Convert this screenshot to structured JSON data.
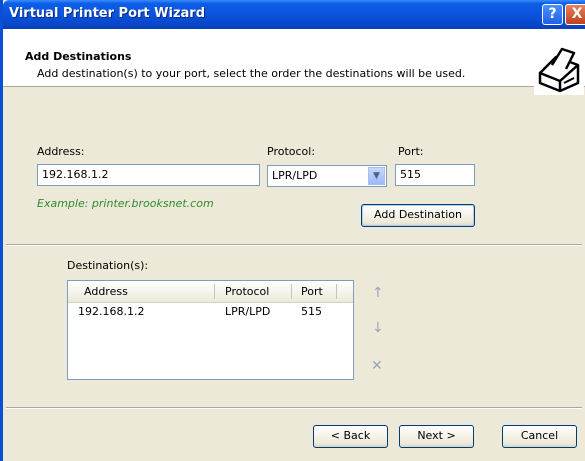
{
  "window": {
    "title": "Virtual Printer Port Wizard",
    "help_label": "?",
    "close_label": "X"
  },
  "header": {
    "title": "Add Destinations",
    "subtitle": "Add destination(s) to your port, select the order the destinations will be used."
  },
  "form": {
    "address_label": "Address:",
    "address_value": "192.168.1.2",
    "protocol_label": "Protocol:",
    "protocol_value": "LPR/LPD",
    "port_label": "Port:",
    "port_value": "515",
    "example_text": "Example: printer.brooksnet.com",
    "add_destination_label": "Add Destination"
  },
  "destinations": {
    "label": "Destination(s):",
    "columns": [
      "Address",
      "Protocol",
      "Port"
    ],
    "rows": [
      {
        "address": "192.168.1.2",
        "protocol": "LPR/LPD",
        "port": "515"
      }
    ]
  },
  "side_buttons": {
    "up": "↑",
    "down": "↓",
    "remove": "✕"
  },
  "footer": {
    "back_label": "< Back",
    "next_label": "Next >",
    "cancel_label": "Cancel"
  },
  "colors": {
    "title_bar": "#0a55e0",
    "example_text": "#2e8b2e",
    "face": "#ece9d8"
  },
  "icons": {
    "wizard_icon": "printer-icon",
    "up": "arrow-up-icon",
    "down": "arrow-down-icon",
    "remove": "remove-icon",
    "dropdown": "chevron-down-icon"
  }
}
